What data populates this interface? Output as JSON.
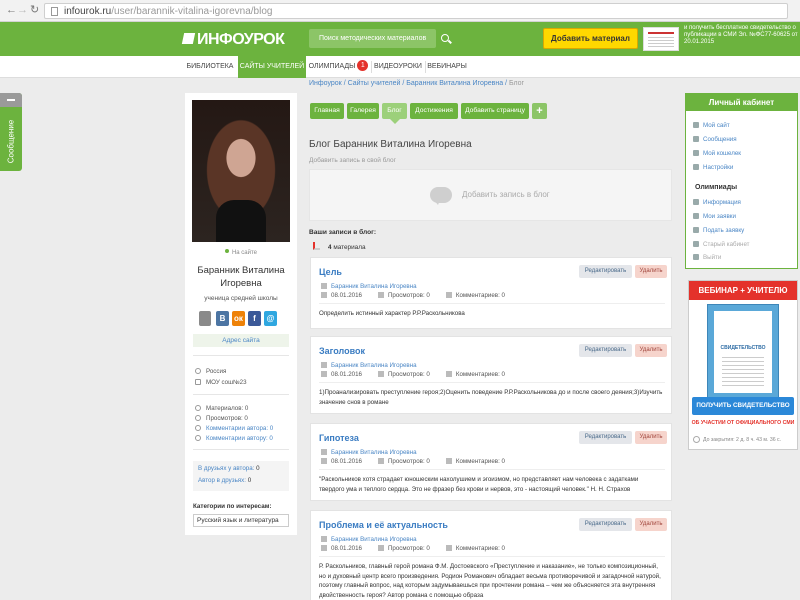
{
  "browser": {
    "url_host": "infourok.ru",
    "url_path": "/user/barannik-vitalina-igorevna/blog"
  },
  "header": {
    "logo": "ИНФОУРОК",
    "search_placeholder": "Поиск методических материалов",
    "add_material": "Добавить материал",
    "cert_text": "и получить бесплатное свидетельство о публикации в СМИ Эл. №ФС77-60625 от 20.01.2015"
  },
  "nav": {
    "items": [
      "БИБЛИОТЕКА",
      "САЙТЫ УЧИТЕЛЕЙ",
      "ОЛИМПИАДЫ",
      "ВИДЕОУРОКИ",
      "ВЕБИНАРЫ"
    ],
    "olympiad_badge": "1"
  },
  "sidetab": {
    "label": "Сообщение"
  },
  "profile": {
    "status": "На сайте",
    "name": "Баранник Виталина Игоревна",
    "role": "ученица средней школы",
    "site_address": "Адрес сайта",
    "country": "Россия",
    "school": "МОУ сош№23",
    "stats": [
      "Материалов: 0",
      "Просмотров: 0",
      "Комментарии автора: 0",
      "Комментарии автору: 0"
    ],
    "friends_of_author_label": "В друзьях у автора:",
    "friends_of_author": "0",
    "author_in_friends_label": "Автор в друзьях:",
    "author_in_friends": "0",
    "interests_heading": "Категории по интересам:",
    "interests_value": "Русский язык и литература"
  },
  "breadcrumb": {
    "items": [
      "Инфоурок",
      "Сайты учителей",
      "Баранник Виталина Игоревна"
    ],
    "current": "Блог"
  },
  "tabs": [
    "Главная",
    "Галерея",
    "Блог",
    "Достижения",
    "Добавить страницу"
  ],
  "tab_plus": "+",
  "blog": {
    "title": "Блог Баранник Виталина Игоревна",
    "add_hint": "Добавить запись в свой блог",
    "add_box": "Добавить запись в блог",
    "my_posts": "Ваши записи в блог:",
    "count_num": "4",
    "count_label": "материала",
    "edit_label": "Редактировать",
    "delete_label": "Удалить",
    "views_label": "Просмотров: 0",
    "comments_label": "Комментариев: 0"
  },
  "posts": [
    {
      "title": "Цель",
      "author": "Баранник Виталина Игоревна",
      "date": "08.01.2016",
      "text": "Определить истинный характер Р.Р.Раскольникова"
    },
    {
      "title": "Заголовок",
      "author": "Баранник Виталина Игоревна",
      "date": "08.01.2016",
      "text": "1)Проанализировать преступление героя;2)Оценить поведение Р.Р.Раскольникова до и после своего деяния;3)Изучить значение снов в романе"
    },
    {
      "title": "Гипотеза",
      "author": "Баранник Виталина Игоревна",
      "date": "08.01.2016",
      "text": "\"Раскольников хотя страдает юношеским нахолушием и эгоизмом, но представляет нам человека с задатками твердого ума и теплого сердца. Это не фразер без крови и нервов, это - настоящий человек.\" Н. Н. Страхов"
    },
    {
      "title": "Проблема и её актуальность",
      "author": "Баранник Виталина Игоревна",
      "date": "08.01.2016",
      "text": "Р. Раскольников, главный герой романа Ф.М. Достоевского «Преступление и наказание», не только композиционный, но и духовный центр всего произведения. Родион Романович обладает весьма противоречивой и загадочной натурой, поэтому главный вопрос, над которым задумываешься при прочтении романа – чем же объясняется эта внутренняя двойственность героя? Автор романа с помощью образа"
    }
  ],
  "cabinet": {
    "title": "Личный кабинет",
    "items": [
      "Мой сайт",
      "Сообщения",
      "Мой кошелек",
      "Настройки"
    ],
    "olymp_heading": "Олимпиады",
    "olymp_items": [
      "Информация",
      "Мои заявки",
      "Подать заявку",
      "Старый кабинет",
      "Выйти"
    ]
  },
  "webinar": {
    "title": "ВЕБИНАР + УЧИТЕЛЮ",
    "doc_title": "СВИДЕТЕЛЬСТВО",
    "button": "ПОЛУЧИТЬ СВИДЕТЕЛЬСТВО",
    "sub": "ОБ УЧАСТИИ ОТ ОФИЦИАЛЬНОГО СМИ",
    "timer_label": "До закрытия:",
    "timer_value": "2 д.  8 ч.  43 м.  36 с."
  },
  "colors": {
    "brand_green": "#6cb33e",
    "accent_yellow": "#ffd800",
    "link_blue": "#4a86c5",
    "badge_red": "#e4322b"
  }
}
